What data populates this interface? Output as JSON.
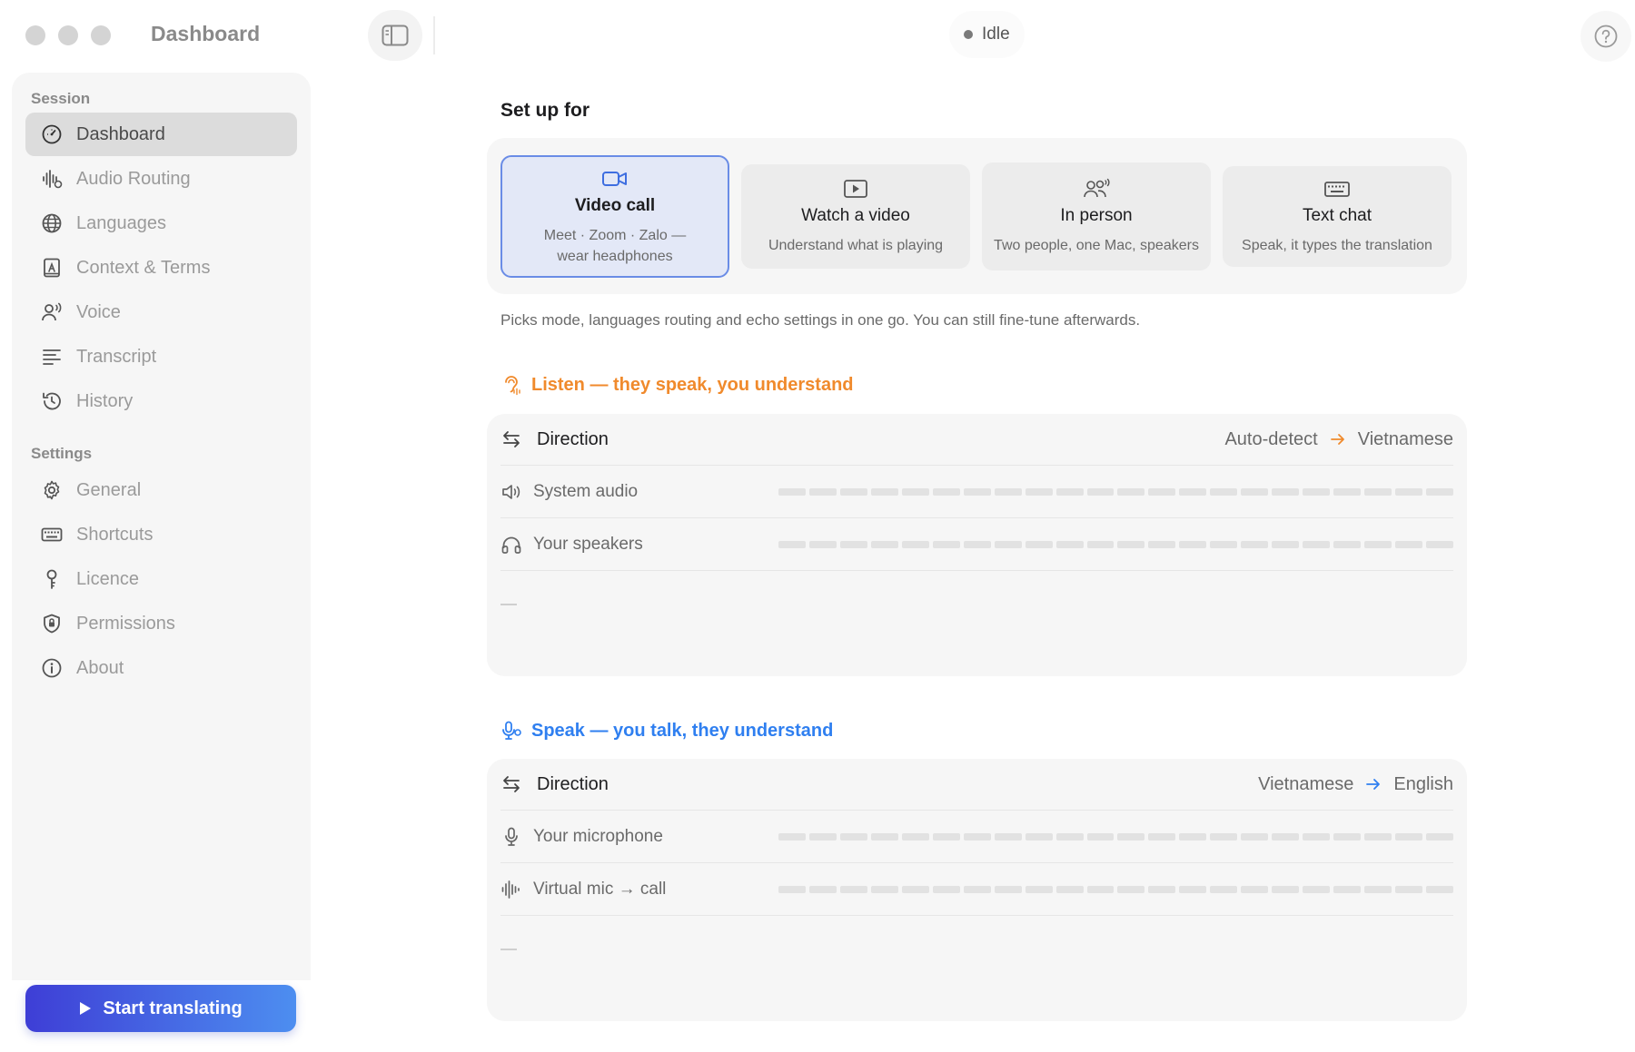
{
  "window": {
    "title": "Dashboard",
    "status": "Idle"
  },
  "sidebar": {
    "session_label": "Session",
    "session_items": [
      {
        "label": "Dashboard",
        "icon": "dashboard-icon",
        "active": true
      },
      {
        "label": "Audio Routing",
        "icon": "audio-routing-icon"
      },
      {
        "label": "Languages",
        "icon": "globe-icon"
      },
      {
        "label": "Context & Terms",
        "icon": "book-icon"
      },
      {
        "label": "Voice",
        "icon": "voice-icon"
      },
      {
        "label": "Transcript",
        "icon": "transcript-icon"
      },
      {
        "label": "History",
        "icon": "history-icon"
      }
    ],
    "settings_label": "Settings",
    "settings_items": [
      {
        "label": "General",
        "icon": "gear-icon"
      },
      {
        "label": "Shortcuts",
        "icon": "keyboard-icon"
      },
      {
        "label": "Licence",
        "icon": "key-icon"
      },
      {
        "label": "Permissions",
        "icon": "shield-icon"
      },
      {
        "label": "About",
        "icon": "info-icon"
      }
    ],
    "start_button": "Start translating"
  },
  "setup": {
    "heading": "Set up for",
    "presets": [
      {
        "title": "Video call",
        "desc_line1": "Meet · Zoom · Zalo —",
        "desc_line2": "wear headphones",
        "icon": "video-camera-icon",
        "selected": true
      },
      {
        "title": "Watch a video",
        "desc_line1": "Understand what is playing",
        "icon": "play-icon"
      },
      {
        "title": "In person",
        "desc_line1": "Two people, one Mac, speakers",
        "icon": "people-icon"
      },
      {
        "title": "Text chat",
        "desc_line1": "Speak, it types the translation",
        "icon": "keyboard-icon"
      }
    ],
    "hint": "Picks mode, languages routing and echo settings in one go. You can still fine-tune afterwards."
  },
  "listen": {
    "heading": "Listen — they speak, you understand",
    "accent": "#f08a2c",
    "direction_label": "Direction",
    "from": "Auto-detect",
    "to": "Vietnamese",
    "sources": [
      {
        "label": "System audio",
        "icon": "speaker-icon",
        "level": 0
      },
      {
        "label": "Your speakers",
        "icon": "headphones-icon",
        "level": 0
      }
    ],
    "placeholder": "—"
  },
  "speak": {
    "heading": "Speak — you talk, they understand",
    "accent": "#2f7ff0",
    "direction_label": "Direction",
    "from": "Vietnamese",
    "to": "English",
    "sources": [
      {
        "label": "Your microphone",
        "icon": "microphone-icon",
        "level": 0
      },
      {
        "label": "Virtual mic → call",
        "icon": "waveform-icon",
        "level": 0
      }
    ],
    "placeholder": "—"
  }
}
